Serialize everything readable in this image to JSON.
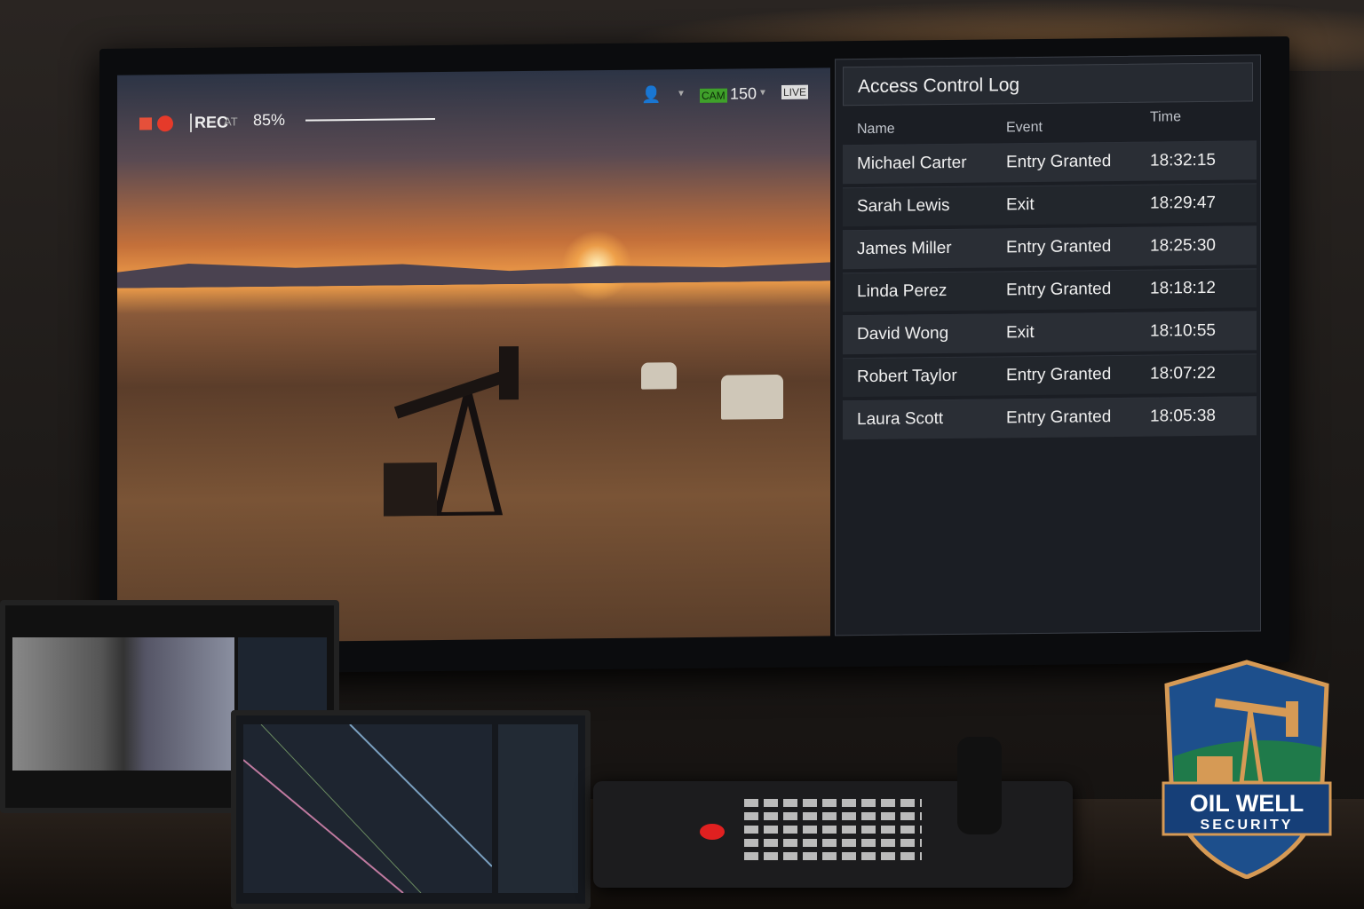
{
  "osd": {
    "rec_label": "REC",
    "auto_label": "AT",
    "zoom_percent": "85%",
    "cam_badge": "CAM",
    "cam_number": "150",
    "live_badge": "LIVE"
  },
  "access_log": {
    "title": "Access Control Log",
    "columns": [
      "Name",
      "Event",
      "Time"
    ],
    "rows": [
      {
        "name": "Michael Carter",
        "event": "Entry Granted",
        "time": "18:32:15"
      },
      {
        "name": "Sarah Lewis",
        "event": "Exit",
        "time": "18:29:47"
      },
      {
        "name": "James Miller",
        "event": "Entry Granted",
        "time": "18:25:30"
      },
      {
        "name": "Linda Perez",
        "event": "Entry Granted",
        "time": "18:18:12"
      },
      {
        "name": "David Wong",
        "event": "Exit",
        "time": "18:10:55"
      },
      {
        "name": "Robert Taylor",
        "event": "Entry Granted",
        "time": "18:07:22"
      },
      {
        "name": "Laura Scott",
        "event": "Entry Granted",
        "time": "18:05:38"
      }
    ]
  },
  "logo": {
    "line1": "OIL WELL",
    "line2": "SECURITY"
  },
  "colors": {
    "rec": "#e53a2a",
    "cam_badge": "#3fa02a",
    "shield_blue": "#1d4f8c",
    "shield_gold": "#d69a55"
  }
}
